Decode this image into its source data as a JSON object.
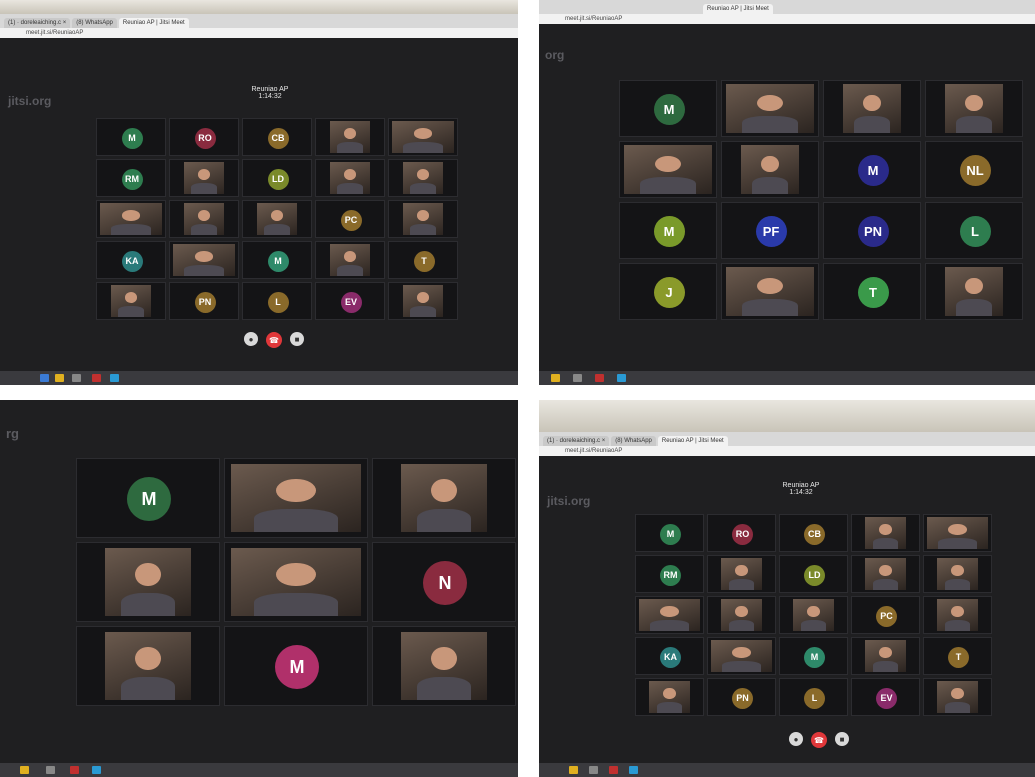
{
  "photos": [
    {
      "tabs": [
        "(1) · doreleaiching.c ×",
        "(8) WhatsApp",
        "Reuniao AP | Jitsi Meet"
      ],
      "address": "meet.jit.si/ReuniaoAP",
      "brand": "jitsi.org",
      "meeting_title": "Reuniao AP",
      "meeting_time": "1:14:32",
      "tiles": [
        {
          "label": "M",
          "color": "#2e7d4f"
        },
        {
          "label": "RO",
          "color": "#8a2b3f"
        },
        {
          "label": "CB",
          "color": "#8a6a2a"
        },
        {
          "label": "",
          "color": ""
        },
        {
          "label": "",
          "color": ""
        },
        {
          "label": "RM",
          "color": "#2e7d4f"
        },
        {
          "label": "",
          "color": ""
        },
        {
          "label": "LD",
          "color": "#7a8a2a"
        },
        {
          "label": "",
          "color": ""
        },
        {
          "label": "",
          "color": ""
        },
        {
          "label": "",
          "color": ""
        },
        {
          "label": "",
          "color": ""
        },
        {
          "label": "",
          "color": ""
        },
        {
          "label": "PC",
          "color": "#8a6a2a"
        },
        {
          "label": "",
          "color": ""
        },
        {
          "label": "KA",
          "color": "#2a7a7a"
        },
        {
          "label": "",
          "color": ""
        },
        {
          "label": "M",
          "color": "#2e8a6a"
        },
        {
          "label": "",
          "color": ""
        },
        {
          "label": "T",
          "color": "#8a6a2a"
        },
        {
          "label": "",
          "color": ""
        },
        {
          "label": "PN",
          "color": "#8a6a2a"
        },
        {
          "label": "L",
          "color": "#8a6a2a"
        },
        {
          "label": "EV",
          "color": "#8a2b6a"
        },
        {
          "label": "",
          "color": ""
        }
      ]
    },
    {
      "tabs": [
        "Reuniao AP | Jitsi Meet"
      ],
      "address": "meet.jit.si/ReuniaoAP",
      "brand": "org",
      "tiles": [
        {
          "label": "M",
          "color": "#2e6a3f"
        },
        {
          "label": "",
          "color": ""
        },
        {
          "label": "",
          "color": ""
        },
        {
          "label": "",
          "color": ""
        },
        {
          "label": "",
          "color": ""
        },
        {
          "label": "",
          "color": ""
        },
        {
          "label": "M",
          "color": "#2a2a8a"
        },
        {
          "label": "NL",
          "color": "#8a6a2a"
        },
        {
          "label": "M",
          "color": "#7a9a2a"
        },
        {
          "label": "PF",
          "color": "#2a3aaa"
        },
        {
          "label": "PN",
          "color": "#2a2a8a"
        },
        {
          "label": "L",
          "color": "#2e7d4f"
        },
        {
          "label": "J",
          "color": "#8a9a2a"
        },
        {
          "label": "",
          "color": ""
        },
        {
          "label": "T",
          "color": "#3a9a4a"
        },
        {
          "label": "",
          "color": ""
        }
      ]
    },
    {
      "brand": "rg",
      "tiles": [
        {
          "label": "M",
          "color": "#2e6a3f"
        },
        {
          "label": "",
          "color": ""
        },
        {
          "label": "",
          "color": ""
        },
        {
          "label": "",
          "color": ""
        },
        {
          "label": "",
          "color": ""
        },
        {
          "label": "N",
          "color": "#8a2b3f"
        },
        {
          "label": "",
          "color": ""
        },
        {
          "label": "M",
          "color": "#b0306a"
        },
        {
          "label": "",
          "color": ""
        }
      ]
    },
    {
      "tabs": [
        "(1) · doreleaiching.c ×",
        "(8) WhatsApp",
        "Reuniao AP | Jitsi Meet"
      ],
      "address": "meet.jit.si/ReuniaoAP",
      "brand": "jitsi.org",
      "meeting_title": "Reuniao AP",
      "meeting_time": "1:14:32",
      "tiles": [
        {
          "label": "M",
          "color": "#2e7d4f"
        },
        {
          "label": "RO",
          "color": "#8a2b3f"
        },
        {
          "label": "CB",
          "color": "#8a6a2a"
        },
        {
          "label": "",
          "color": ""
        },
        {
          "label": "",
          "color": ""
        },
        {
          "label": "RM",
          "color": "#2e7d4f"
        },
        {
          "label": "",
          "color": ""
        },
        {
          "label": "LD",
          "color": "#7a8a2a"
        },
        {
          "label": "",
          "color": ""
        },
        {
          "label": "",
          "color": ""
        },
        {
          "label": "",
          "color": ""
        },
        {
          "label": "",
          "color": ""
        },
        {
          "label": "",
          "color": ""
        },
        {
          "label": "PC",
          "color": "#8a6a2a"
        },
        {
          "label": "",
          "color": ""
        },
        {
          "label": "KA",
          "color": "#2a7a7a"
        },
        {
          "label": "",
          "color": ""
        },
        {
          "label": "M",
          "color": "#2e8a6a"
        },
        {
          "label": "",
          "color": ""
        },
        {
          "label": "T",
          "color": "#8a6a2a"
        },
        {
          "label": "",
          "color": ""
        },
        {
          "label": "PN",
          "color": "#8a6a2a"
        },
        {
          "label": "L",
          "color": "#8a6a2a"
        },
        {
          "label": "EV",
          "color": "#8a2b6a"
        },
        {
          "label": "",
          "color": ""
        }
      ]
    }
  ],
  "controls": {
    "hangup_color": "#e0373a",
    "button_color": "#d9d9d9"
  },
  "accent_active": "#2a7fd4"
}
